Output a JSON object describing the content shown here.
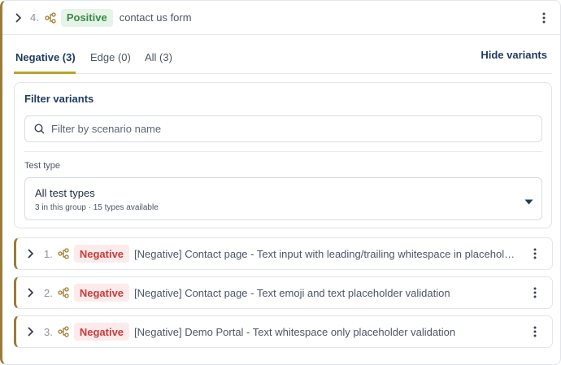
{
  "header": {
    "index": "4.",
    "badge": "Positive",
    "title": "contact us form"
  },
  "tabs": [
    {
      "label": "Negative (3)",
      "active": true
    },
    {
      "label": "Edge (0)",
      "active": false
    },
    {
      "label": "All (3)",
      "active": false
    }
  ],
  "hide_variants_label": "Hide variants",
  "filter": {
    "title": "Filter variants",
    "search_placeholder": "Filter by scenario name",
    "search_value": "",
    "test_type_label": "Test type",
    "select_value": "All test types",
    "select_sub": "3 in this group · 15 types available"
  },
  "variants": [
    {
      "index": "1.",
      "badge": "Negative",
      "text": "[Negative] Contact page - Text input with leading/trailing whitespace in placeholder validation"
    },
    {
      "index": "2.",
      "badge": "Negative",
      "text": "[Negative] Contact page - Text emoji and text placeholder validation"
    },
    {
      "index": "3.",
      "badge": "Negative",
      "text": "[Negative] Demo Portal - Text whitespace only placeholder validation"
    }
  ],
  "colors": {
    "accent_border": "#9a7b3a",
    "tab_underline": "#b8a52a",
    "positive_bg": "#e6f4e8",
    "positive_text": "#3a8a46",
    "negative_bg": "#fdeaea",
    "negative_text": "#c93b3b",
    "heading": "#1e3a5f"
  },
  "icons": [
    "chevron-right-icon",
    "flow-icon",
    "kebab-icon",
    "search-icon",
    "caret-down-icon"
  ]
}
